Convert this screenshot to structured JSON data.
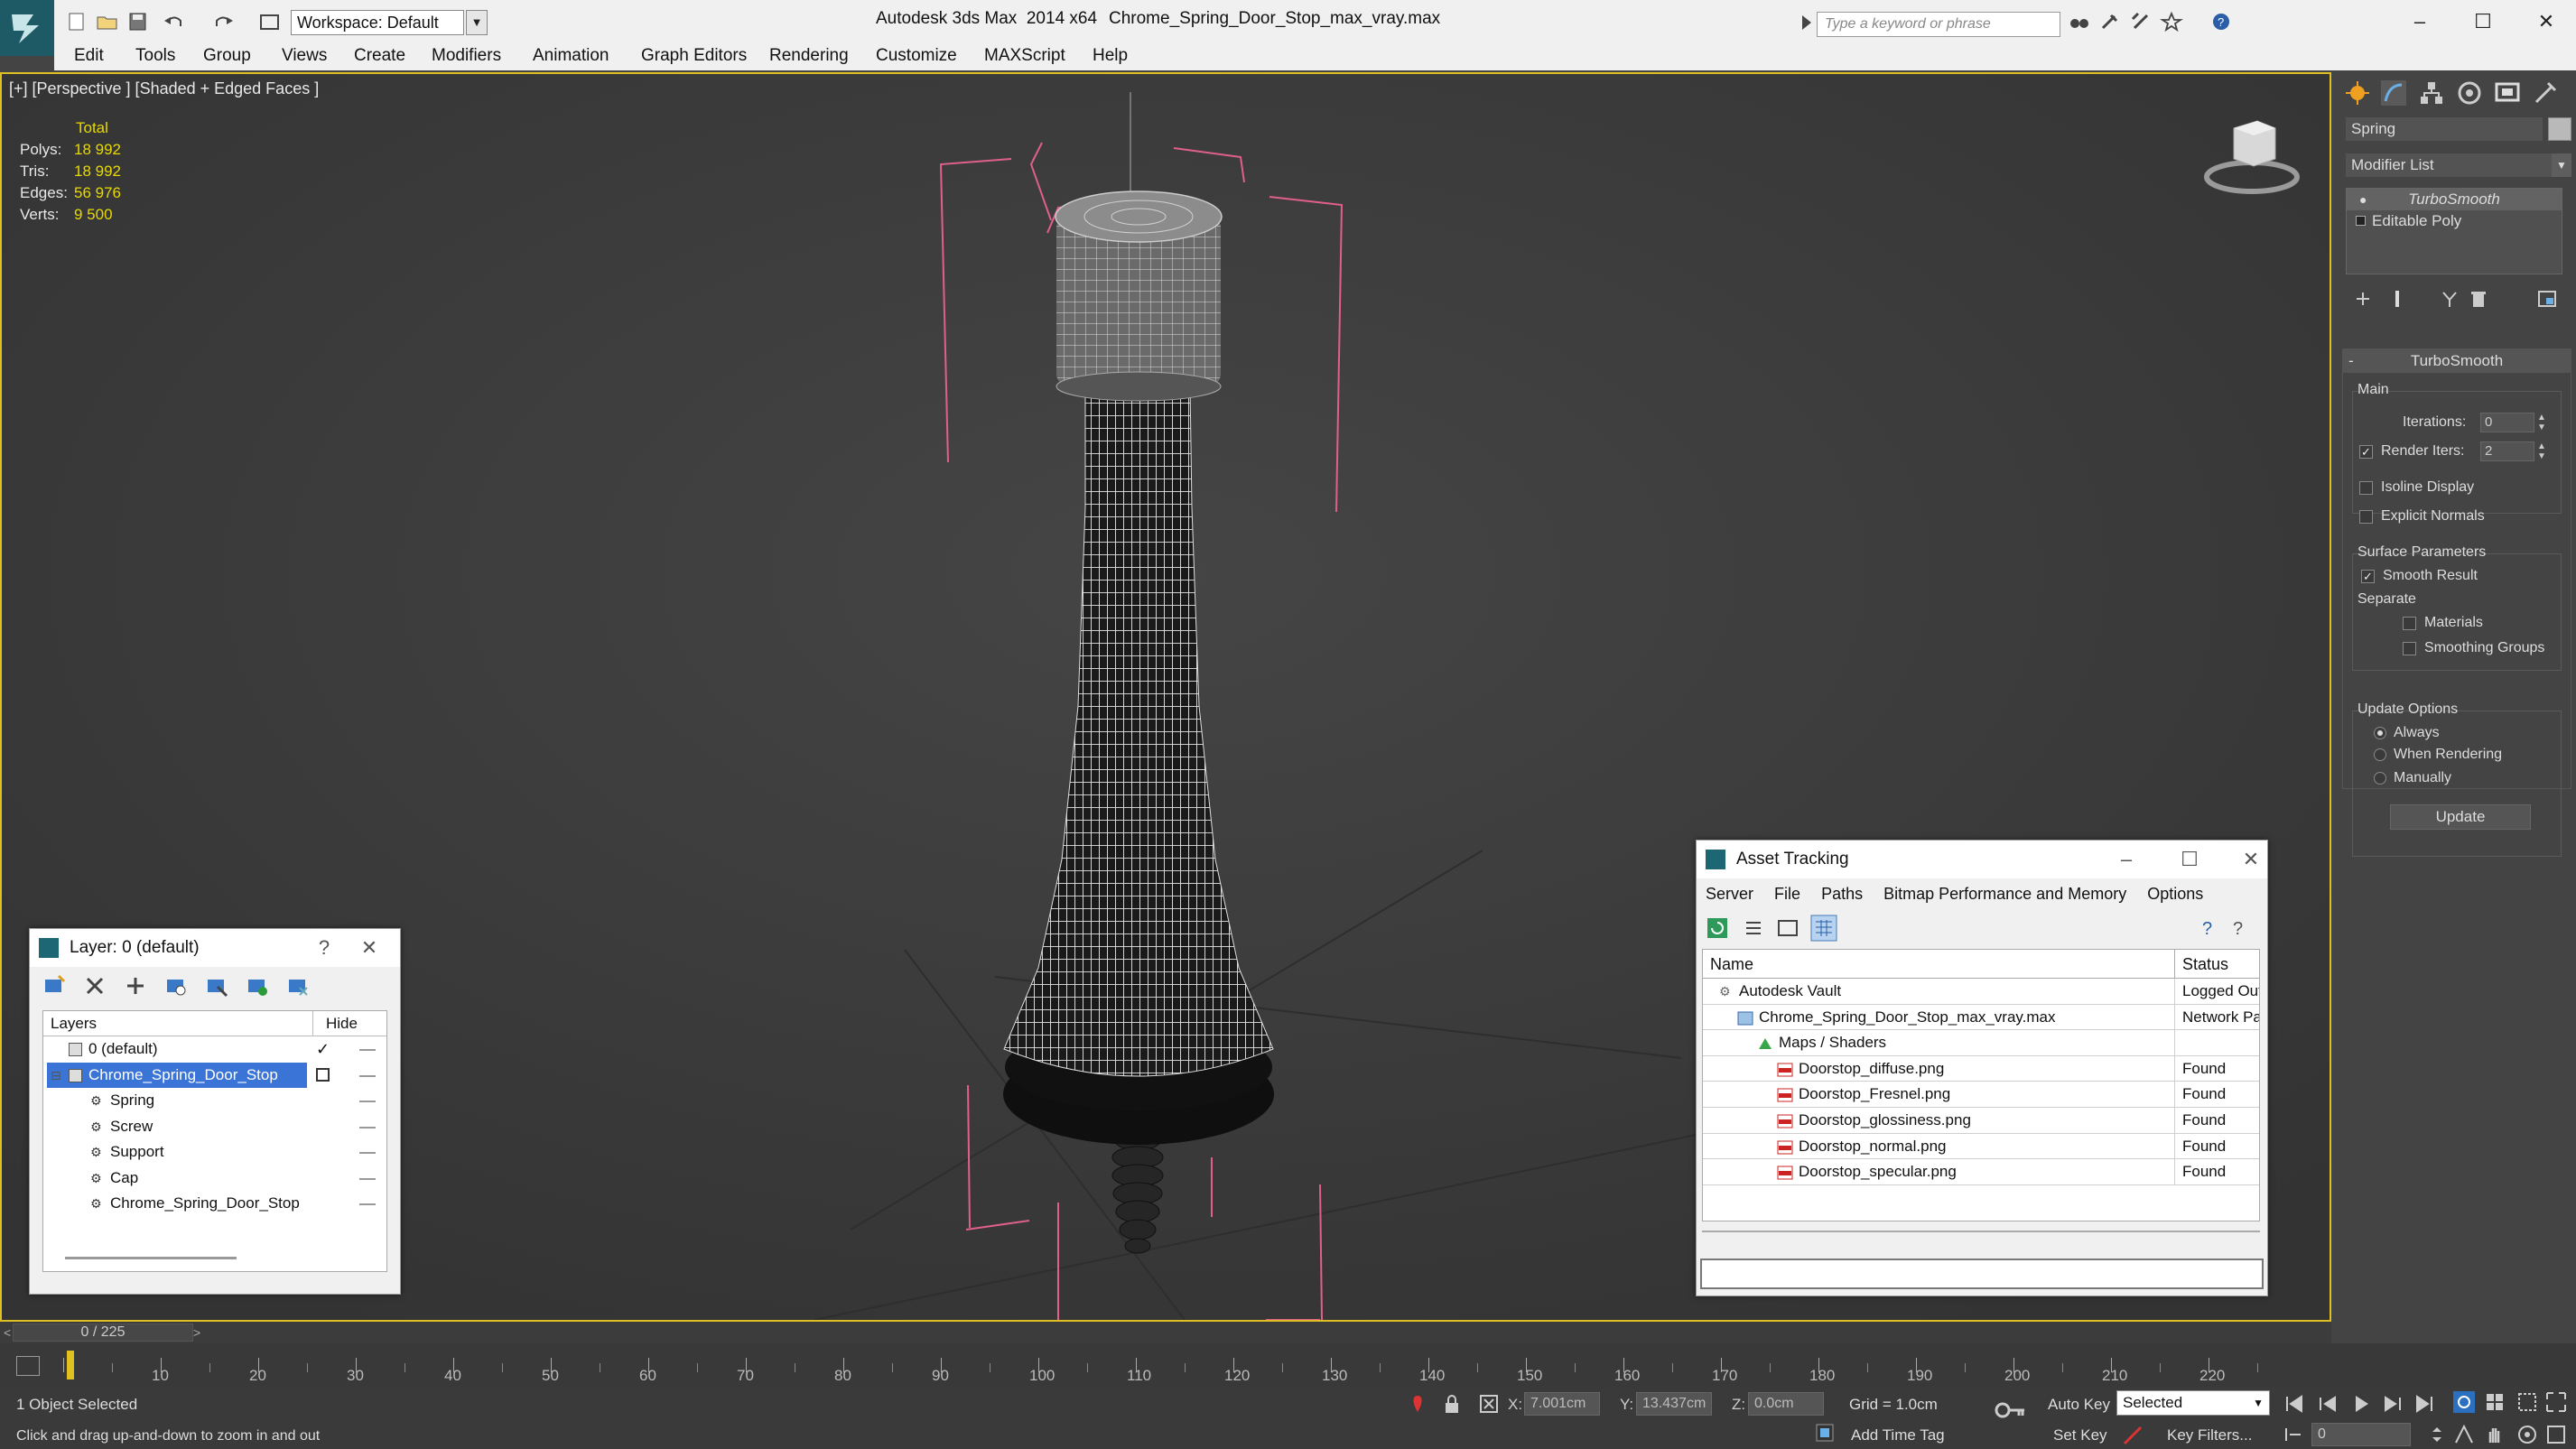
{
  "titlebar": {
    "workspace": "Workspace: Default",
    "app_title": "Autodesk 3ds Max  2014 x64",
    "file_title": "Chrome_Spring_Door_Stop_max_vray.max",
    "search_placeholder": "Type a keyword or phrase"
  },
  "menu": [
    "Edit",
    "Tools",
    "Group",
    "Views",
    "Create",
    "Modifiers",
    "Animation",
    "Graph Editors",
    "Rendering",
    "Customize",
    "MAXScript",
    "Help"
  ],
  "viewport": {
    "label": "[+] [Perspective ] [Shaded + Edged Faces ]",
    "stats_header": "Total",
    "stats": [
      {
        "key": "Polys:",
        "value": "18 992"
      },
      {
        "key": "Tris:",
        "value": "18 992"
      },
      {
        "key": "Edges:",
        "value": "56 976"
      },
      {
        "key": "Verts:",
        "value": "9 500"
      }
    ]
  },
  "layer_panel": {
    "title": "Layer: 0 (default)",
    "help": "?",
    "col_layers": "Layers",
    "col_hide": "Hide",
    "rows": [
      {
        "name": "0 (default)",
        "indent": 0
      },
      {
        "name": "Chrome_Spring_Door_Stop",
        "indent": 0,
        "selected": true
      },
      {
        "name": "Spring",
        "indent": 1
      },
      {
        "name": "Screw",
        "indent": 1
      },
      {
        "name": "Support",
        "indent": 1
      },
      {
        "name": "Cap",
        "indent": 1
      },
      {
        "name": "Chrome_Spring_Door_Stop",
        "indent": 1
      }
    ]
  },
  "asset_panel": {
    "title": "Asset Tracking",
    "menu": [
      "Server",
      "File",
      "Paths",
      "Bitmap Performance and Memory",
      "Options"
    ],
    "col_name": "Name",
    "col_status": "Status",
    "rows": [
      {
        "name": "Autodesk Vault",
        "status": "Logged Out",
        "indent": 1
      },
      {
        "name": "Chrome_Spring_Door_Stop_max_vray.max",
        "status": "Network Pa",
        "indent": 2
      },
      {
        "name": "Maps / Shaders",
        "status": "",
        "indent": 3
      },
      {
        "name": "Doorstop_diffuse.png",
        "status": "Found",
        "indent": 4
      },
      {
        "name": "Doorstop_Fresnel.png",
        "status": "Found",
        "indent": 4
      },
      {
        "name": "Doorstop_glossiness.png",
        "status": "Found",
        "indent": 4
      },
      {
        "name": "Doorstop_normal.png",
        "status": "Found",
        "indent": 4
      },
      {
        "name": "Doorstop_specular.png",
        "status": "Found",
        "indent": 4
      }
    ]
  },
  "command_panel": {
    "object_name": "Spring",
    "modifier_list": "Modifier List",
    "stack": [
      "TurboSmooth",
      "Editable Poly"
    ],
    "rollout_title": "TurboSmooth",
    "main_label": "Main",
    "iterations_label": "Iterations:",
    "iterations_value": "0",
    "render_iters_label": "Render Iters:",
    "render_iters_value": "2",
    "isoline": "Isoline Display",
    "explicit_normals": "Explicit Normals",
    "surface_params": "Surface Parameters",
    "smooth_result": "Smooth Result",
    "separate": "Separate",
    "materials": "Materials",
    "smoothing_groups": "Smoothing Groups",
    "update_options": "Update Options",
    "always": "Always",
    "when_rendering": "When Rendering",
    "manually": "Manually",
    "update_button": "Update"
  },
  "timeline": {
    "slider": "0 / 225",
    "ticks": [
      "10",
      "20",
      "30",
      "40",
      "50",
      "60",
      "70",
      "80",
      "90",
      "100",
      "110",
      "120",
      "130",
      "140",
      "150",
      "160",
      "170",
      "180",
      "190",
      "200",
      "210",
      "220"
    ]
  },
  "status": {
    "selection": "1 Object Selected",
    "prompt": "Click and drag up-and-down to zoom in and out",
    "x_label": "X:",
    "x_value": "7.001cm",
    "y_label": "Y:",
    "y_value": "13.437cm",
    "z_label": "Z:",
    "z_value": "0.0cm",
    "grid": "Grid = 1.0cm",
    "auto_key": "Auto Key",
    "selected": "Selected",
    "set_key": "Set Key",
    "key_filters": "Key Filters...",
    "add_time_tag": "Add Time Tag",
    "frame": "0"
  },
  "colors": {
    "viewport_border": "#e0c020",
    "stat_value": "#e8d900",
    "selection_blue": "#3a74d7",
    "bbox_pink": "#e0608a"
  }
}
